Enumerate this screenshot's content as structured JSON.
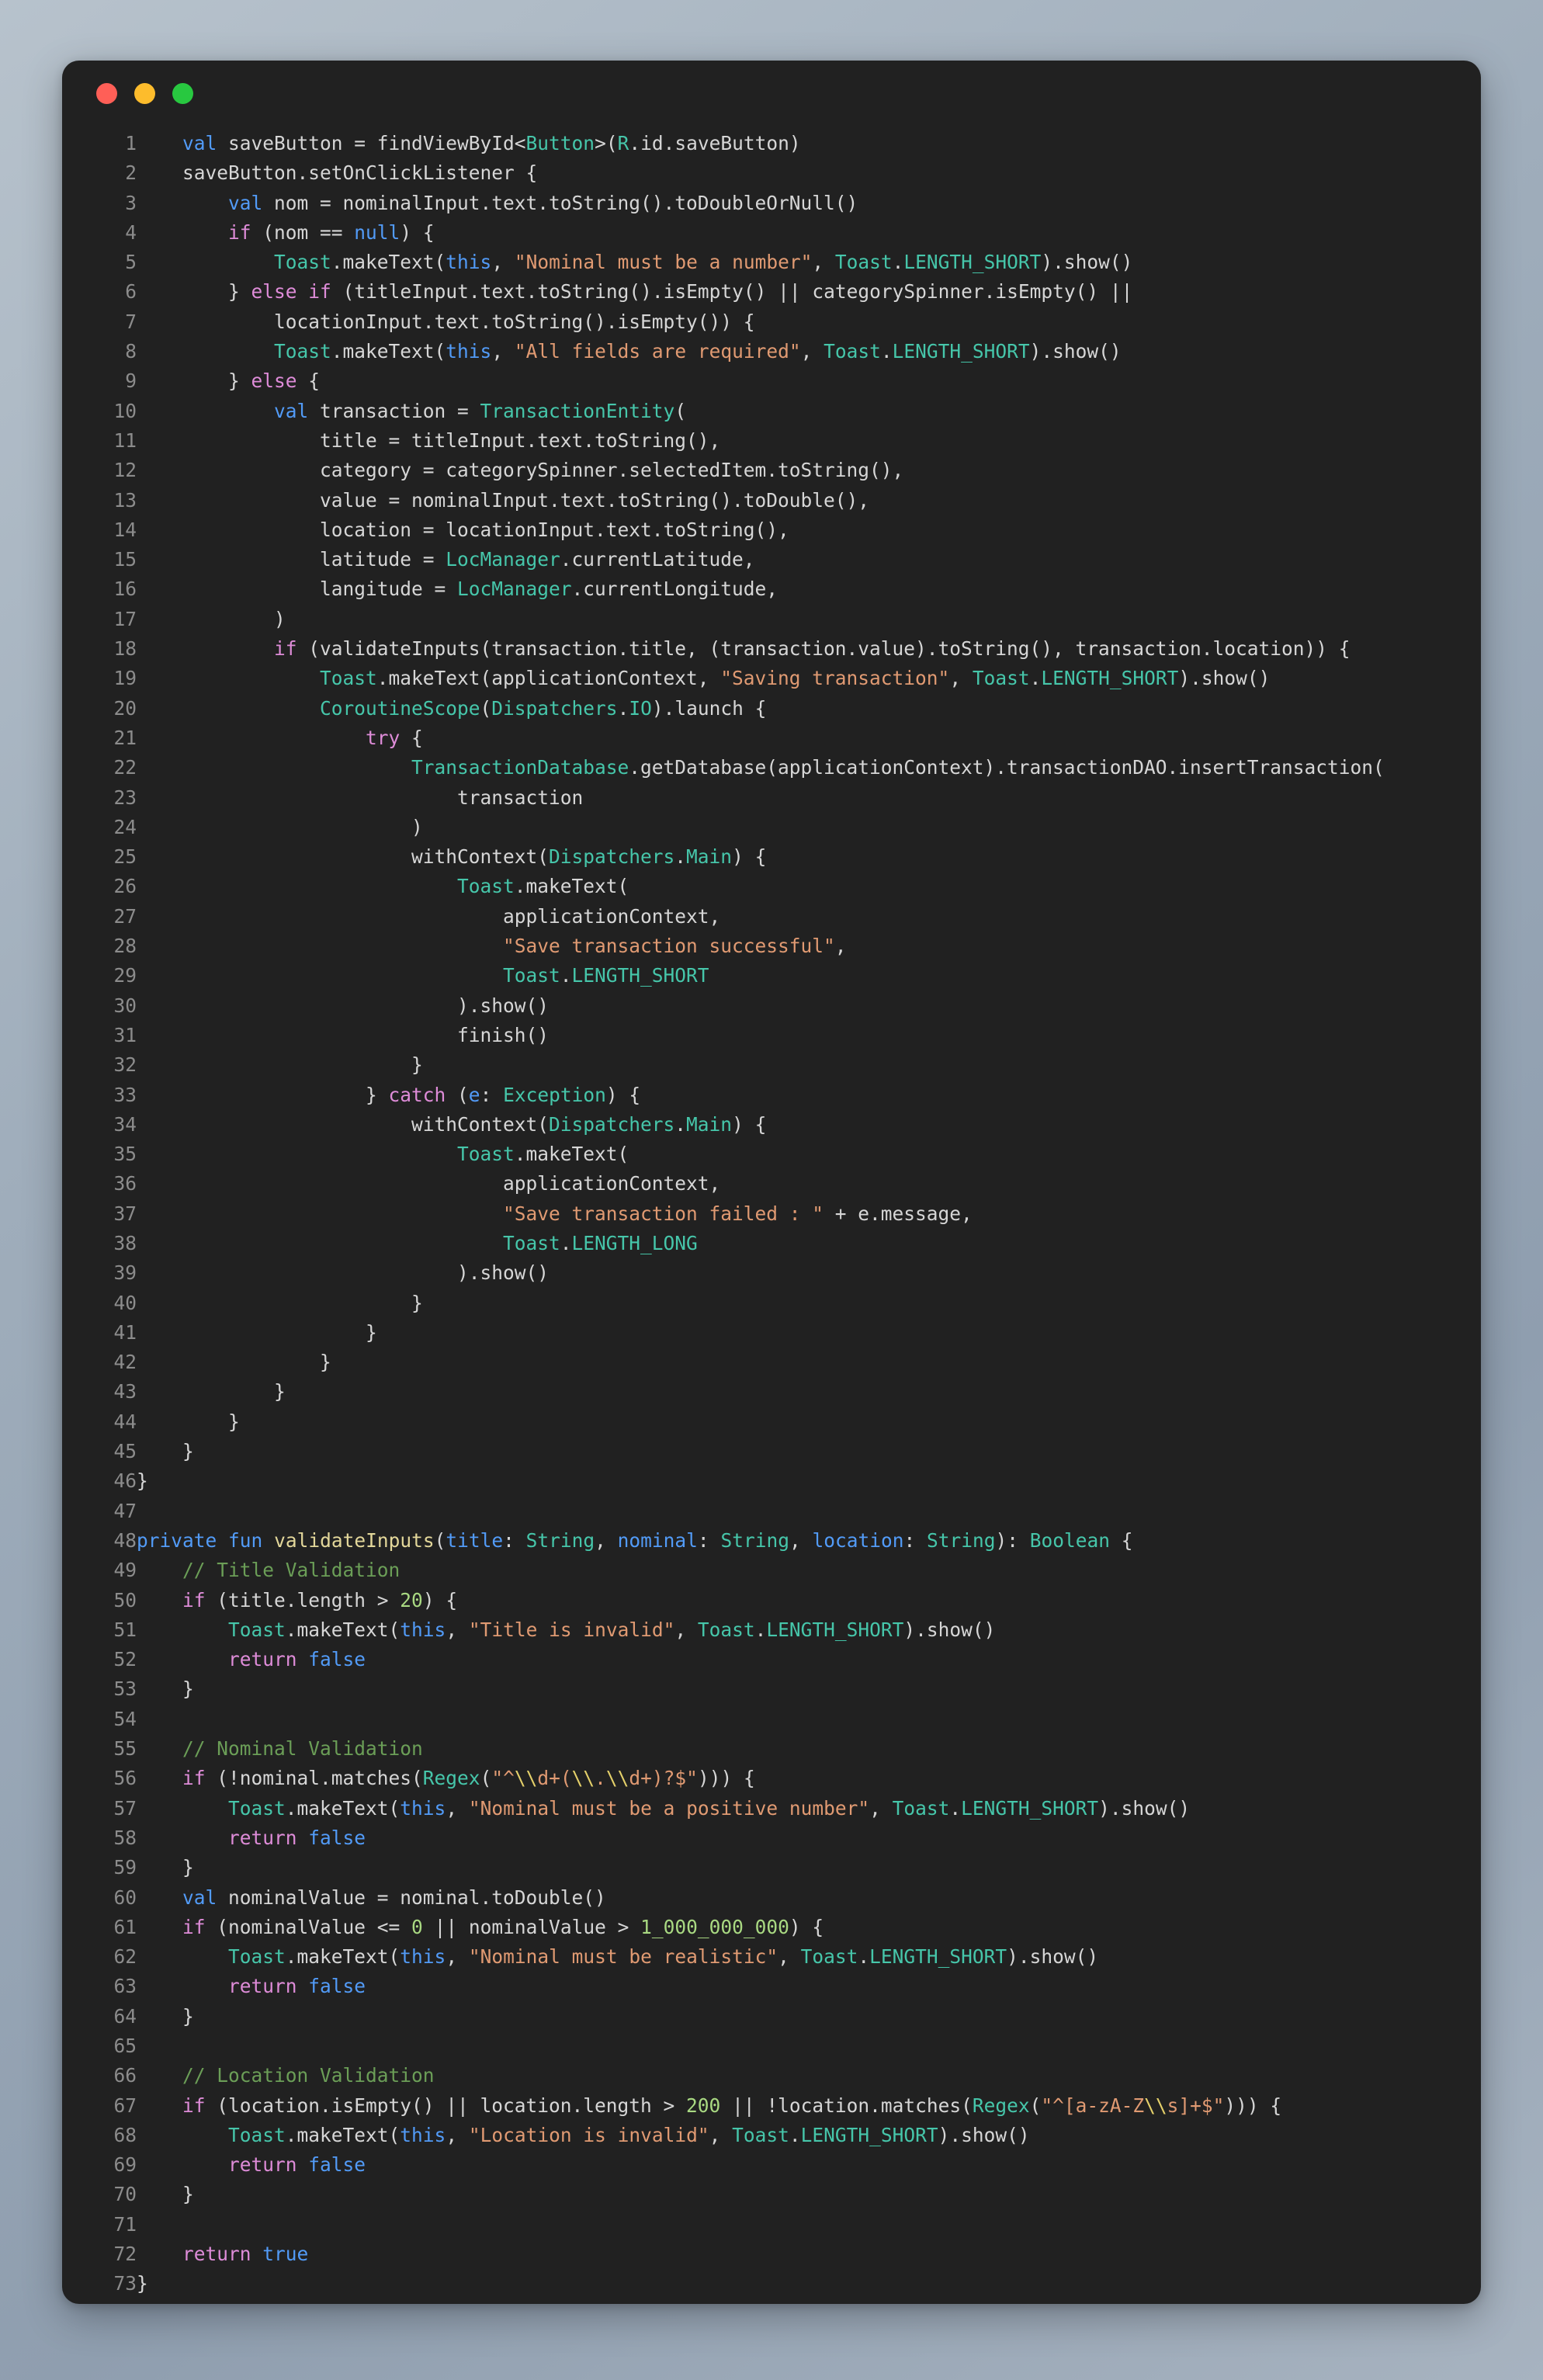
{
  "window": {
    "traffic_lights": [
      {
        "name": "close",
        "color": "#FF5F57"
      },
      {
        "name": "minimize",
        "color": "#FDBC2C"
      },
      {
        "name": "maximize",
        "color": "#28C840"
      }
    ],
    "background": "#212121"
  },
  "theme": {
    "keyword": "#529BF7",
    "control": "#DE8CD8",
    "type": "#46C6AA",
    "string": "#E09A72",
    "escape": "#E4D06A",
    "comment": "#6B9E57",
    "number": "#A9D982",
    "function": "#E3D79A",
    "plain": "#D6D6D6",
    "line_number": "#8C8C8C"
  },
  "editor": {
    "language": "kotlin",
    "first_line": 1,
    "last_line": 73,
    "line_numbers": [
      "1",
      "2",
      "3",
      "4",
      "5",
      "6",
      "7",
      "8",
      "9",
      "10",
      "11",
      "12",
      "13",
      "14",
      "15",
      "16",
      "17",
      "18",
      "19",
      "20",
      "21",
      "22",
      "23",
      "24",
      "25",
      "26",
      "27",
      "28",
      "29",
      "30",
      "31",
      "32",
      "33",
      "34",
      "35",
      "36",
      "37",
      "38",
      "39",
      "40",
      "41",
      "42",
      "43",
      "44",
      "45",
      "46",
      "47",
      "48",
      "49",
      "50",
      "51",
      "52",
      "53",
      "54",
      "55",
      "56",
      "57",
      "58",
      "59",
      "60",
      "61",
      "62",
      "63",
      "64",
      "65",
      "66",
      "67",
      "68",
      "69",
      "70",
      "71",
      "72",
      "73"
    ],
    "lines": [
      "    val saveButton = findViewById<Button>(R.id.saveButton)",
      "    saveButton.setOnClickListener {",
      "        val nom = nominalInput.text.toString().toDoubleOrNull()",
      "        if (nom == null) {",
      "            Toast.makeText(this, \"Nominal must be a number\", Toast.LENGTH_SHORT).show()",
      "        } else if (titleInput.text.toString().isEmpty() || categorySpinner.isEmpty() ||",
      "            locationInput.text.toString().isEmpty()) {",
      "            Toast.makeText(this, \"All fields are required\", Toast.LENGTH_SHORT).show()",
      "        } else {",
      "            val transaction = TransactionEntity(",
      "                title = titleInput.text.toString(),",
      "                category = categorySpinner.selectedItem.toString(),",
      "                value = nominalInput.text.toString().toDouble(),",
      "                location = locationInput.text.toString(),",
      "                latitude = LocManager.currentLatitude,",
      "                langitude = LocManager.currentLongitude,",
      "            )",
      "            if (validateInputs(transaction.title, (transaction.value).toString(), transaction.location)) {",
      "                Toast.makeText(applicationContext, \"Saving transaction\", Toast.LENGTH_SHORT).show()",
      "                CoroutineScope(Dispatchers.IO).launch {",
      "                    try {",
      "                        TransactionDatabase.getDatabase(applicationContext).transactionDAO.insertTransaction(",
      "                            transaction",
      "                        )",
      "                        withContext(Dispatchers.Main) {",
      "                            Toast.makeText(",
      "                                applicationContext,",
      "                                \"Save transaction successful\",",
      "                                Toast.LENGTH_SHORT",
      "                            ).show()",
      "                            finish()",
      "                        }",
      "                    } catch (e: Exception) {",
      "                        withContext(Dispatchers.Main) {",
      "                            Toast.makeText(",
      "                                applicationContext,",
      "                                \"Save transaction failed : \" + e.message,",
      "                                Toast.LENGTH_LONG",
      "                            ).show()",
      "                        }",
      "                    }",
      "                }",
      "            }",
      "        }",
      "    }",
      "}",
      "",
      "private fun validateInputs(title: String, nominal: String, location: String): Boolean {",
      "    // Title Validation",
      "    if (title.length > 20) {",
      "        Toast.makeText(this, \"Title is invalid\", Toast.LENGTH_SHORT).show()",
      "        return false",
      "    }",
      "",
      "    // Nominal Validation",
      "    if (!nominal.matches(Regex(\"^\\\\d+(\\\\.\\\\d+)?$\"))) {",
      "        Toast.makeText(this, \"Nominal must be a positive number\", Toast.LENGTH_SHORT).show()",
      "        return false",
      "    }",
      "    val nominalValue = nominal.toDouble()",
      "    if (nominalValue <= 0 || nominalValue > 1_000_000_000) {",
      "        Toast.makeText(this, \"Nominal must be realistic\", Toast.LENGTH_SHORT).show()",
      "        return false",
      "    }",
      "",
      "    // Location Validation",
      "    if (location.isEmpty() || location.length > 200 || !location.matches(Regex(\"^[a-zA-Z\\\\s]+$\"))) {",
      "        Toast.makeText(this, \"Location is invalid\", Toast.LENGTH_SHORT).show()",
      "        return false",
      "    }",
      "",
      "    return true",
      "}"
    ],
    "string_literals": [
      "Nominal must be a number",
      "All fields are required",
      "Saving transaction",
      "Save transaction successful",
      "Save transaction failed : ",
      "Title is invalid",
      "Nominal must be a positive number",
      "Nominal must be realistic",
      "Location is invalid",
      "^\\d+(\\.\\d+)?$",
      "^[a-zA-Z\\s]+$"
    ],
    "comments": [
      "// Title Validation",
      "// Nominal Validation",
      "// Location Validation"
    ],
    "numbers": [
      "20",
      "0",
      "1_000_000_000",
      "200"
    ]
  }
}
